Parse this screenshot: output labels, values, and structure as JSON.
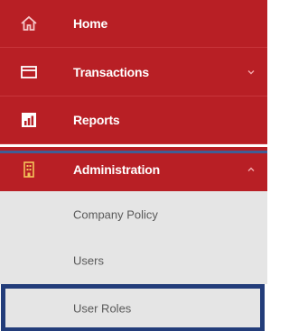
{
  "nav": {
    "items": [
      {
        "label": "Home",
        "icon": "home-icon"
      },
      {
        "label": "Transactions",
        "icon": "card-icon",
        "chevron": "chevron-down"
      },
      {
        "label": "Reports",
        "icon": "chart-icon"
      },
      {
        "label": "Administration",
        "icon": "building-icon",
        "chevron": "chevron-up"
      }
    ],
    "sub_items": [
      {
        "label": "Company Policy"
      },
      {
        "label": "Users"
      },
      {
        "label": "User Roles"
      }
    ]
  },
  "colors": {
    "brand_red": "#b81f25",
    "submenu_bg": "#e5e5e5",
    "highlight_border": "#233d7a",
    "divider_blue": "#3f5e96"
  }
}
